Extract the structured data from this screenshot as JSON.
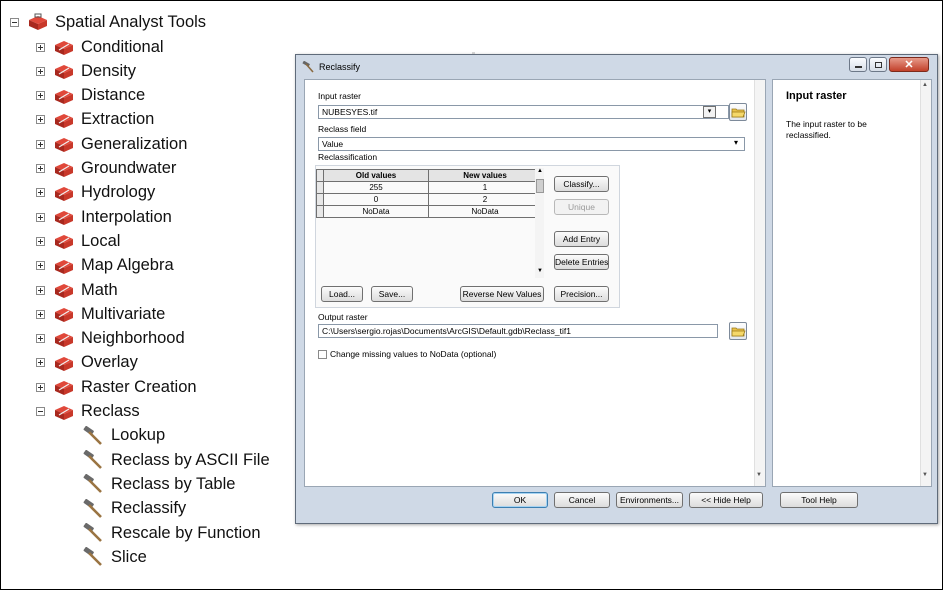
{
  "toolbox": {
    "root_label": "Spatial Analyst Tools",
    "toolsets": [
      "Conditional",
      "Density",
      "Distance",
      "Extraction",
      "Generalization",
      "Groundwater",
      "Hydrology",
      "Interpolation",
      "Local",
      "Map Algebra",
      "Math",
      "Multivariate",
      "Neighborhood",
      "Overlay",
      "Raster Creation",
      "Reclass"
    ],
    "reclass_tools": [
      "Lookup",
      "Reclass by ASCII File",
      "Reclass by Table",
      "Reclassify",
      "Rescale by Function",
      "Slice"
    ]
  },
  "dialog": {
    "title": "Reclassify",
    "close_glyph": "✕",
    "input_raster": {
      "label": "Input raster",
      "value": "NUBESYES.tif"
    },
    "reclass_field": {
      "label": "Reclass field",
      "value": "Value"
    },
    "reclassification": {
      "label": "Reclassification",
      "columns": [
        "Old values",
        "New values"
      ],
      "rows": [
        {
          "old": "255",
          "new": "1"
        },
        {
          "old": "0",
          "new": "2"
        },
        {
          "old": "NoData",
          "new": "NoData"
        }
      ],
      "side_buttons": [
        "Classify...",
        "Unique",
        "Add Entry",
        "Delete Entries"
      ],
      "bottom_buttons": [
        "Load...",
        "Save...",
        "Reverse New Values",
        "Precision..."
      ]
    },
    "output_raster": {
      "label": "Output raster",
      "value": "C:\\Users\\sergio.rojas\\Documents\\ArcGIS\\Default.gdb\\Reclass_tif1"
    },
    "change_missing": {
      "label": "Change missing values to NoData (optional)",
      "checked": false
    },
    "footer_buttons": [
      "OK",
      "Cancel",
      "Environments...",
      "<< Hide Help",
      "Tool Help"
    ]
  },
  "help": {
    "title": "Input raster",
    "text": "The input raster to be reclassified."
  }
}
